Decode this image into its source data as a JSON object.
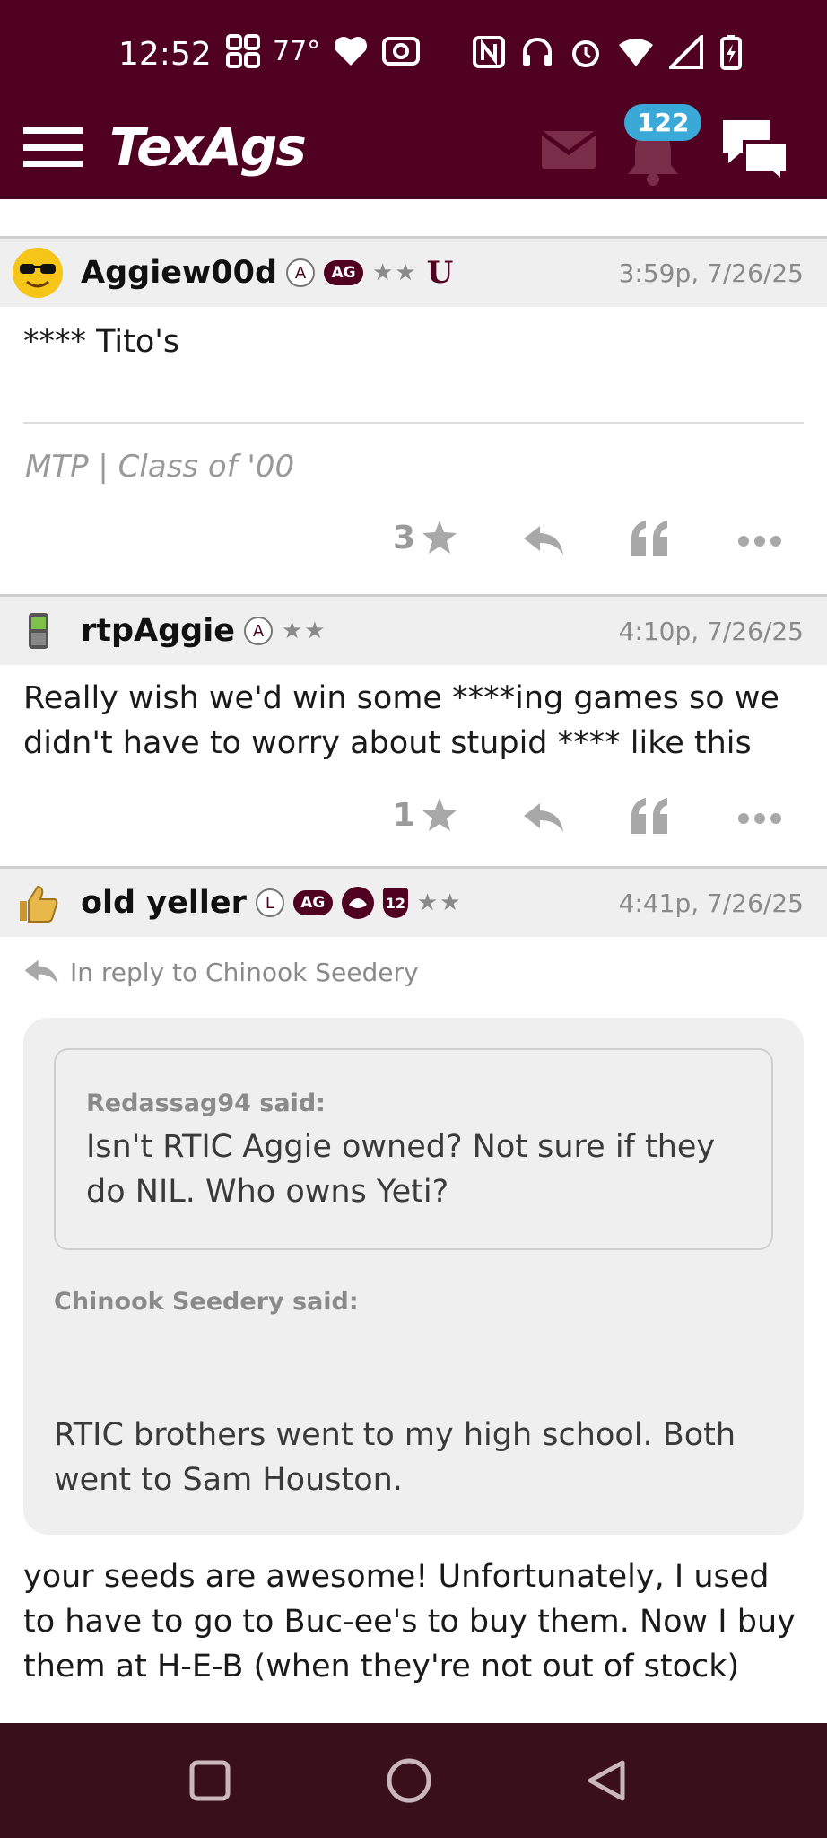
{
  "status_bar": {
    "time": "12:52",
    "temperature": "77°"
  },
  "app": {
    "logo": "TexAgs",
    "notification_count": "122",
    "brand_color": "#500021"
  },
  "posts": [
    {
      "username": "Aggiew00d",
      "badges": [
        "A",
        "AG",
        "★★",
        "U"
      ],
      "timestamp": "3:59p, 7/26/25",
      "body": "**** Tito's",
      "signature": "MTP | Class of '00",
      "star_count": "3"
    },
    {
      "username": "rtpAggie",
      "badges": [
        "A",
        "★★"
      ],
      "timestamp": "4:10p, 7/26/25",
      "body": "Really wish we'd win some ****ing games so we didn't have to worry about stupid **** like this",
      "star_count": "1"
    },
    {
      "username": "old yeller",
      "badges": [
        "L",
        "AG",
        "12",
        "★★"
      ],
      "timestamp": "4:41p, 7/26/25",
      "reply_to": "In reply to Chinook Seedery",
      "quote_outer_author": "Chinook Seedery said:",
      "quote_inner_author": "Redassag94 said:",
      "quote_inner_text": "Isn't RTIC Aggie owned? Not sure if they do NIL. Who owns Yeti?",
      "quote_outer_text": "RTIC brothers went to my high school. Both went to Sam Houston.",
      "body": "your seeds are awesome! Unfortunately, I used to have to go to Buc-ee's to buy them. Now I buy them at H-E-B (when they're not out of stock)"
    }
  ],
  "icons": {
    "menu": "hamburger-icon",
    "mail": "mail-icon",
    "bell": "bell-icon",
    "chat": "chat-icon",
    "star": "star-icon",
    "reply": "reply-icon",
    "quote": "quote-icon",
    "more": "more-icon"
  }
}
